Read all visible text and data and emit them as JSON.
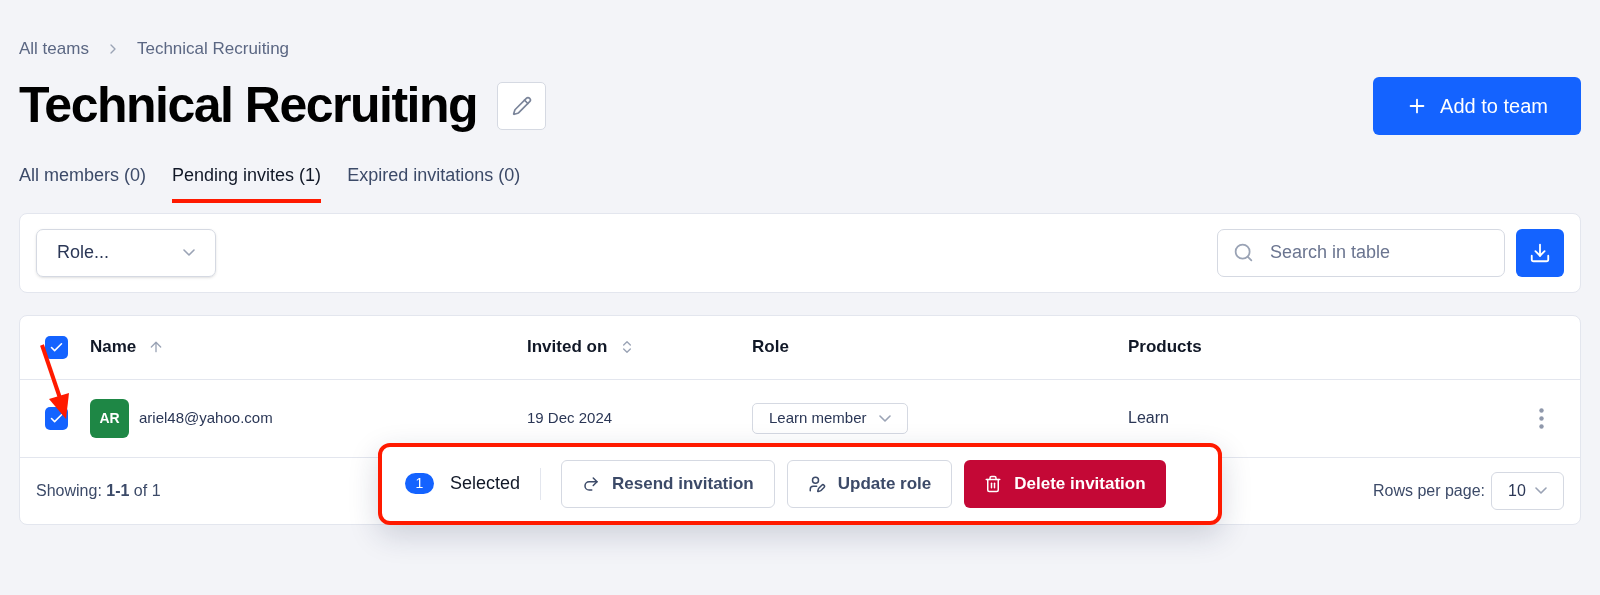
{
  "breadcrumb": [
    "All teams",
    "Technical Recruiting"
  ],
  "title": "Technical Recruiting",
  "add_button": "Add to team",
  "tabs": [
    {
      "label": "All members (0)",
      "selected": false
    },
    {
      "label": "Pending invites (1)",
      "selected": true
    },
    {
      "label": "Expired invitations (0)",
      "selected": false
    }
  ],
  "filters": {
    "role": {
      "placeholder": "Role..."
    },
    "search": {
      "placeholder": "Search in table"
    }
  },
  "table": {
    "select_all_checked": true,
    "columns": [
      {
        "label": "Name",
        "kind": "sort-asc"
      },
      {
        "label": "Invited on",
        "kind": "sortable"
      },
      {
        "label": "Role",
        "kind": "plain"
      },
      {
        "label": "Products",
        "kind": "plain"
      }
    ],
    "rows": [
      {
        "checked": true,
        "initials": "AR",
        "color": "#1e8745",
        "email": "ariel48@yahoo.com",
        "invited_on": "19 Dec 2024",
        "role": "Learn member",
        "products": "Learn"
      }
    ]
  },
  "footer": {
    "showing": "Showing: **1-1** of 1",
    "rows_per_page_label": "Rows per page:",
    "rows_per_page": "10"
  },
  "action_bar": {
    "count": "1",
    "label": "Selected",
    "actions": [
      {
        "kind": "resend",
        "label": "Resend invitation"
      },
      {
        "kind": "update",
        "label": "Update role"
      },
      {
        "kind": "delete",
        "label": "Delete invitation"
      }
    ]
  }
}
